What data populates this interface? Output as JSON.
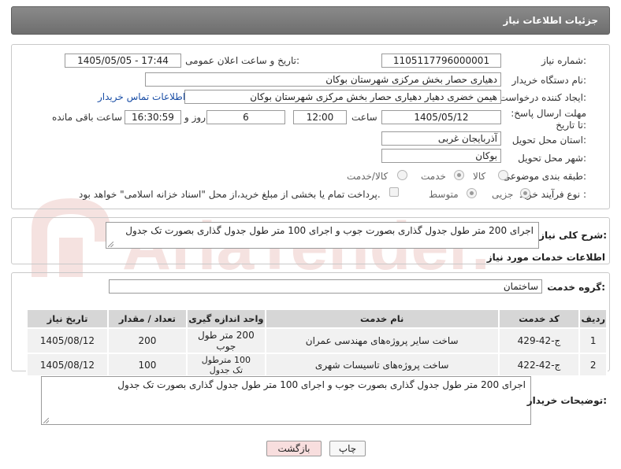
{
  "header": {
    "title": "جزئیات اطلاعات نیاز"
  },
  "form": {
    "need_number_label": "شماره نیاز:",
    "need_number": "1105117796000001",
    "announce_label": "تاریخ و ساعت اعلان عمومی:",
    "announce_value": "1405/05/05 - 17:44",
    "buyer_org_label": "نام دستگاه خریدار:",
    "buyer_org": "دهیاری حصار بخش مرکزی شهرستان بوکان",
    "creator_label": "ایجاد کننده درخواست:",
    "creator": "هیمن خضری دهیار دهیاری حصار بخش مرکزی شهرستان بوکان",
    "contact_link": "اطلاعات تماس خریدار",
    "deadline_label": "مهلت ارسال پاسخ: تا تاریخ:",
    "deadline_date": "1405/05/12",
    "time_label": "ساعت",
    "deadline_time": "12:00",
    "days_value": "6",
    "days_label": "روز و",
    "remaining_value": "16:30:59",
    "remaining_label": "ساعت باقی مانده",
    "province_label": "استان محل تحویل:",
    "province": "آذربایجان غربی",
    "city_label": "شهر محل تحویل:",
    "city": "بوکان",
    "category_label": "طبقه بندی موضوعی:",
    "category_options": [
      "کالا",
      "خدمت",
      "کالا/خدمت"
    ],
    "category_selected": "خدمت",
    "process_label": "نوع فرآیند خرید :",
    "process_options": [
      "جزیی",
      "متوسط"
    ],
    "process_selected": "جزیی",
    "payment_note": "پرداخت تمام یا بخشی از مبلغ خرید،از محل \"اسناد خزانه اسلامی\" خواهد بود."
  },
  "summary": {
    "label": "شرح کلی نیاز:",
    "text": "اجرای 200 متر طول جدول گذاری بصورت جوب و اجرای 100 متر طول جدول گذاری بصورت تک جدول"
  },
  "services": {
    "section_title": "اطلاعات خدمات مورد نیاز",
    "group_label": "گروه خدمت:",
    "group_value": "ساختمان",
    "columns": [
      "ردیف",
      "کد خدمت",
      "نام خدمت",
      "واحد اندازه گیری",
      "تعداد / مقدار",
      "تاریخ نیاز"
    ],
    "rows": [
      [
        "1",
        "ج-42-429",
        "ساخت سایر پروژه‌های مهندسی عمران",
        "200 متر طول جوب",
        "200",
        "1405/08/12"
      ],
      [
        "2",
        "ج-42-422",
        "ساخت پروژه‌های تاسیسات شهری",
        "100 مترطول تک جدول",
        "100",
        "1405/08/12"
      ]
    ]
  },
  "buyer_notes": {
    "label": "توضیحات خریدار:",
    "text": "اجرای 200 متر طول جدول گذاری بصورت جوب و اجرای 100 متر طول جدول گذاری بصورت تک جدول"
  },
  "buttons": {
    "print": "چاپ",
    "back": "بازگشت"
  },
  "watermark": {
    "text": "AriaTender.net"
  },
  "colors": {
    "title_bg": "#7b7b7b",
    "link": "#1a4ea6",
    "header_cell": "#d6d6d6",
    "back_button_bg": "#f8dede"
  }
}
